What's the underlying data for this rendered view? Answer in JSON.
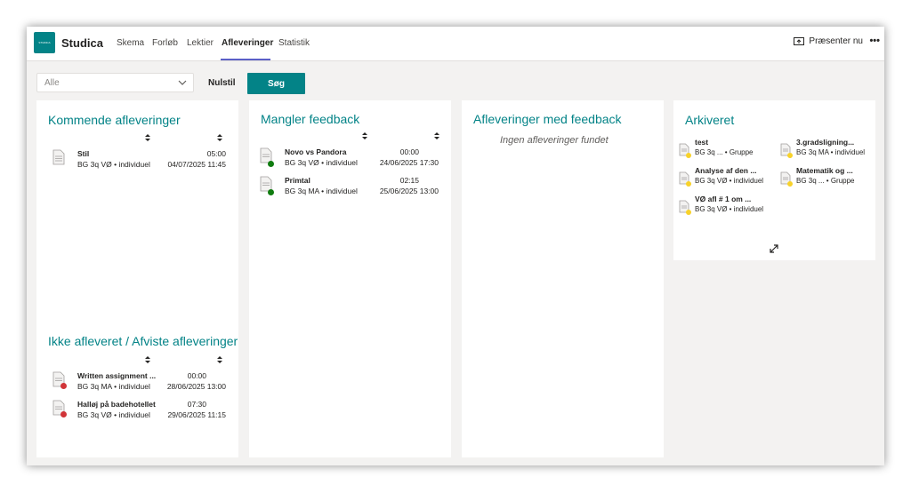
{
  "app": {
    "logo_text": "STUDICA",
    "name": "Studica"
  },
  "nav": {
    "tabs": [
      "Skema",
      "Forløb",
      "Lektier",
      "Afleveringer",
      "Statistik"
    ],
    "active": "Afleveringer",
    "present_label": "Præsenter nu",
    "more_label": "•••"
  },
  "filter": {
    "select_value": "Alle",
    "reset_label": "Nulstil",
    "search_label": "Søg"
  },
  "colors": {
    "accent": "#038387",
    "status_green": "#107c10",
    "status_red": "#d13438",
    "status_yellow": "#f8d22a",
    "nav_underline": "#5b5fc7"
  },
  "icons": {
    "document": "document-icon",
    "sort": "sort-updown-icon",
    "chevron": "chevron-down-icon",
    "present": "present-screen-icon",
    "expand": "expand-arrows-icon"
  },
  "upcoming": {
    "title": "Kommende afleveringer",
    "rows": [
      {
        "title": "Stil",
        "sub": "BG 3q VØ • individuel",
        "time": "05:00",
        "date": "04/07/2025 11:45"
      }
    ]
  },
  "not_submitted": {
    "title": "Ikke afleveret / Afviste afleveringer",
    "rows": [
      {
        "title": "Written assignment ...",
        "sub": "BG 3q MA • individuel",
        "time": "00:00",
        "date": "28/06/2025 13:00",
        "status": "red"
      },
      {
        "title": "Halløj på badehotellet",
        "sub": "BG 3q VØ • individuel",
        "time": "07:30",
        "date": "29/06/2025 11:15",
        "status": "red"
      }
    ]
  },
  "missing_feedback": {
    "title": "Mangler feedback",
    "rows": [
      {
        "title": "Novo vs Pandora",
        "sub": "BG 3q VØ • individuel",
        "time": "00:00",
        "date": "24/06/2025 17:30",
        "status": "green"
      },
      {
        "title": "Primtal",
        "sub": "BG 3q MA • individuel",
        "time": "02:15",
        "date": "25/06/2025 13:00",
        "status": "green"
      }
    ]
  },
  "with_feedback": {
    "title": "Afleveringer med feedback",
    "empty": "Ingen afleveringer fundet"
  },
  "archive": {
    "title": "Arkiveret",
    "items": [
      {
        "title": "test",
        "sub": "BG 3q ...   • Gruppe",
        "status": "yellow"
      },
      {
        "title": "3.gradsligning...",
        "sub": "BG 3q MA • individuel",
        "status": "yellow"
      },
      {
        "title": "Analyse af den ...",
        "sub": "BG 3q VØ • individuel",
        "status": "yellow"
      },
      {
        "title": "Matematik og ...",
        "sub": "BG 3q ...   • Gruppe",
        "status": "yellow"
      },
      {
        "title": "VØ afl # 1 om ...",
        "sub": "BG 3q VØ • individuel",
        "status": "yellow"
      }
    ]
  }
}
